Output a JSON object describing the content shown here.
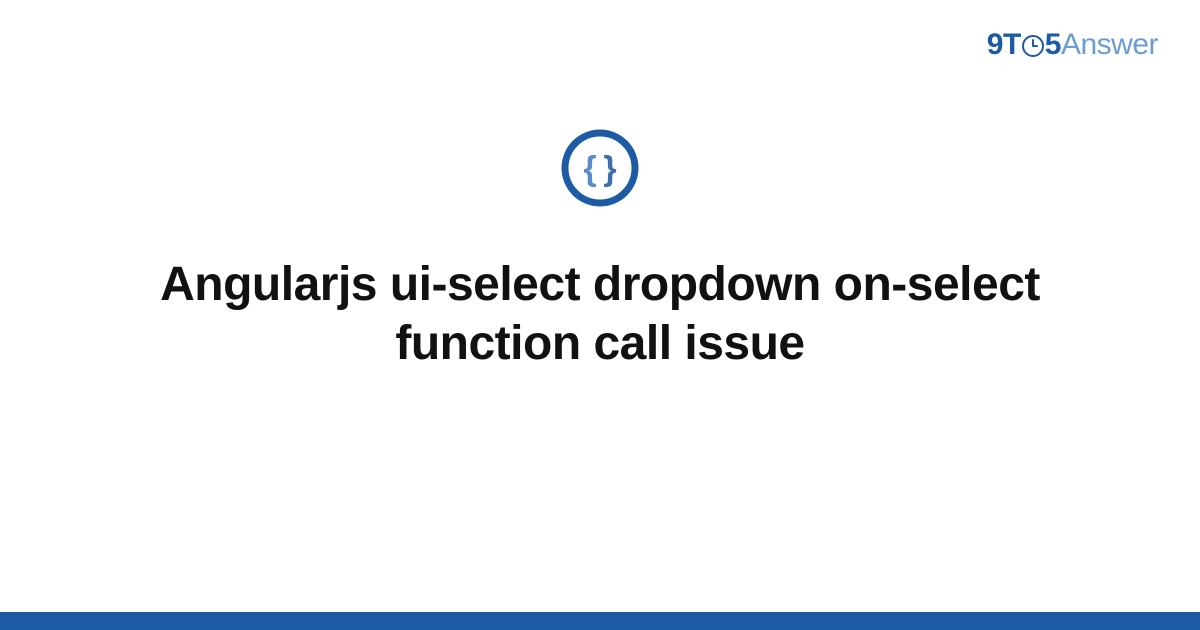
{
  "brand": {
    "part1": "9",
    "part2": "T",
    "part3": "5",
    "part4": "Answer"
  },
  "badge": {
    "name": "code-braces-icon",
    "ring_color": "#1d5ba5",
    "brace_left_color": "#5a8dc8",
    "brace_right_color": "#3e6fa8"
  },
  "title": "Angularjs ui-select dropdown on-select function call issue",
  "colors": {
    "accent": "#1d5ba5",
    "accent_light": "#6b9dd1",
    "text": "#111111",
    "background": "#ffffff"
  }
}
